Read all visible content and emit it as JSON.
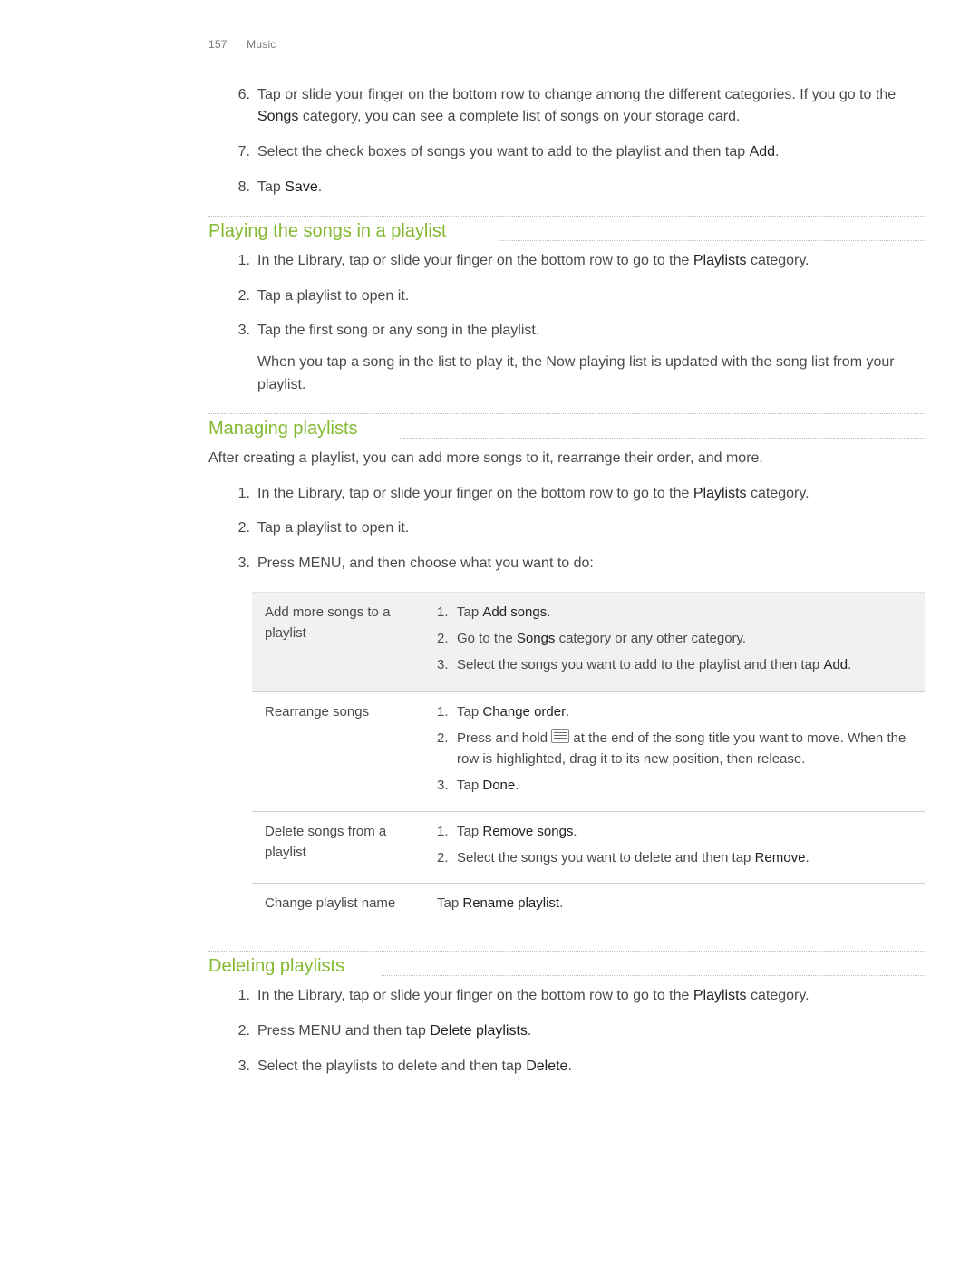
{
  "pageHeader": {
    "number": "157",
    "section": "Music"
  },
  "intro_list": {
    "item6": {
      "num": "6.",
      "pre": "Tap or slide your finger on the bottom row to change among the different categories. If you go to the ",
      "bold": "Songs",
      "post": " category, you can see a complete list of songs on your storage card."
    },
    "item7": {
      "num": "7.",
      "pre": "Select the check boxes of songs you want to add to the playlist and then tap ",
      "bold": "Add",
      "post": "."
    },
    "item8": {
      "num": "8.",
      "pre": "Tap ",
      "bold": "Save",
      "post": "."
    }
  },
  "sections": {
    "playing": {
      "title": "Playing the songs in a playlist",
      "items": {
        "i1": {
          "num": "1.",
          "pre": "In the Library, tap or slide your finger on the bottom row to go to the ",
          "bold": "Playlists",
          "post": " category."
        },
        "i2": {
          "num": "2.",
          "text": "Tap a playlist to open it."
        },
        "i3": {
          "num": "3.",
          "text": "Tap the first song or any song in the playlist.",
          "extra": "When you tap a song in the list to play it, the Now playing list is updated with the song list from your playlist."
        }
      }
    },
    "managing": {
      "title": "Managing playlists",
      "intro": "After creating a playlist, you can add more songs to it, rearrange their order, and more.",
      "items": {
        "i1": {
          "num": "1.",
          "pre": "In the Library, tap or slide your finger on the bottom row to go to the ",
          "bold": "Playlists",
          "post": " category."
        },
        "i2": {
          "num": "2.",
          "text": "Tap a playlist to open it."
        },
        "i3": {
          "num": "3.",
          "text": "Press MENU, and then choose what you want to do:"
        }
      },
      "table": {
        "row1": {
          "label": "Add more songs to a playlist",
          "s1_num": "1.",
          "s1_pre": "Tap ",
          "s1_bold": "Add songs",
          "s1_post": ".",
          "s2_num": "2.",
          "s2_pre": "Go to the ",
          "s2_bold": "Songs",
          "s2_post": " category or any other category.",
          "s3_num": "3.",
          "s3_pre": "Select the songs you want to add to the playlist and then tap ",
          "s3_bold": "Add",
          "s3_post": "."
        },
        "row2": {
          "label": "Rearrange songs",
          "s1_num": "1.",
          "s1_pre": "Tap ",
          "s1_bold": "Change order",
          "s1_post": ".",
          "s2_num": "2.",
          "s2_pre": "Press and hold ",
          "s2_post": " at the end of the song title you want to move. When the row is highlighted, drag it to its new position, then release.",
          "s3_num": "3.",
          "s3_pre": "Tap ",
          "s3_bold": "Done",
          "s3_post": "."
        },
        "row3": {
          "label": "Delete songs from a playlist",
          "s1_num": "1.",
          "s1_pre": "Tap ",
          "s1_bold": "Remove songs",
          "s1_post": ".",
          "s2_num": "2.",
          "s2_pre": "Select the songs you want to delete and then tap ",
          "s2_bold": "Remove",
          "s2_post": "."
        },
        "row4": {
          "label": "Change playlist name",
          "pre": "Tap ",
          "bold": "Rename playlist",
          "post": "."
        }
      }
    },
    "deleting": {
      "title": "Deleting playlists",
      "items": {
        "i1": {
          "num": "1.",
          "pre": "In the Library, tap or slide your finger on the bottom row to go to the ",
          "bold": "Playlists",
          "post": " category."
        },
        "i2": {
          "num": "2.",
          "pre": "Press MENU and then tap ",
          "bold": "Delete playlists",
          "post": "."
        },
        "i3": {
          "num": "3.",
          "pre": "Select the playlists to delete and then tap ",
          "bold": "Delete",
          "post": "."
        }
      }
    }
  }
}
